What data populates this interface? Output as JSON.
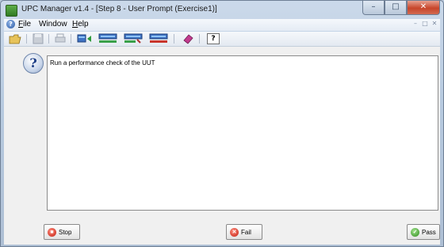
{
  "window": {
    "title": "UPC Manager v1.4 - [Step 8 - User Prompt (Exercise1)]",
    "controls": {
      "minimize": "–",
      "maximize": "□",
      "close": "✕"
    }
  },
  "menubar": {
    "items": [
      {
        "accel": "F",
        "rest": "ile"
      },
      {
        "accel": "",
        "rest": "Window"
      },
      {
        "accel": "H",
        "rest": "elp"
      }
    ],
    "mdi_controls": [
      "–",
      "□",
      "✕"
    ]
  },
  "toolbar": {
    "icons": [
      "open-folder-icon",
      "save-icon",
      "print-icon",
      "step-back-icon",
      "step-list-icon",
      "step-edit-icon",
      "step-run-icon",
      "eraser-icon",
      "help-context-icon"
    ],
    "help_glyph": "?"
  },
  "prompt": {
    "icon_glyph": "?",
    "message": "Run a performance check of the UUT"
  },
  "buttons": {
    "stop": "Stop",
    "fail": "Fail",
    "pass": "Pass"
  },
  "colors": {
    "window_frame": "#b8cbe0",
    "close_button": "#c7452a",
    "pass_green": "#2d8a1d",
    "fail_red": "#c21f12"
  }
}
